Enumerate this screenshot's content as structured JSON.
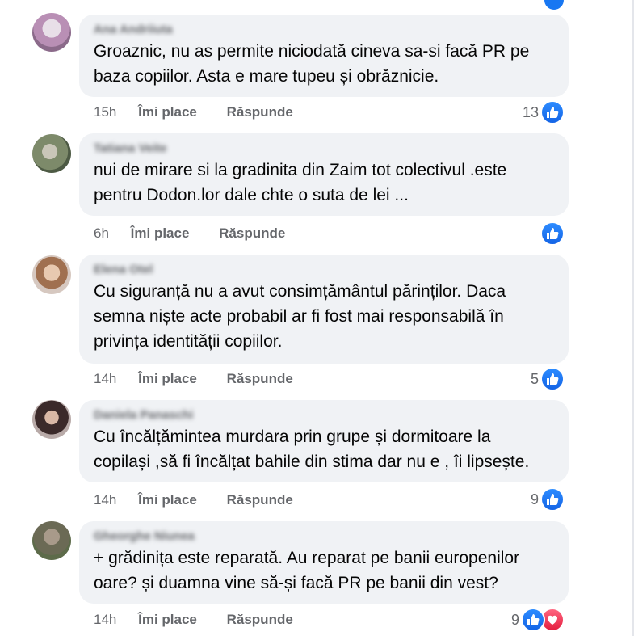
{
  "actions": {
    "like_label": "Îmi place",
    "reply_label": "Răspunde"
  },
  "colors": {
    "like_blue": "#1877f2",
    "love_red": "#f33e58",
    "bubble_bg": "#f0f2f5",
    "meta_gray": "#65676b"
  },
  "icons": {
    "like": "thumbs-up-icon",
    "love": "heart-icon"
  },
  "comments": [
    {
      "author": "Ana Andriiuta",
      "text": "Groaznic, nu as permite niciodată cineva sa-si facă PR pe\nbaza copiilor. Asta e mare tupeu și obrăznicie.",
      "time": "15h",
      "reaction_count": "13",
      "reactions": [
        "like"
      ]
    },
    {
      "author": "Tatiana Veite",
      "text": "nui de mirare si la gradinita din Zaim tot colectivul .este\npentru Dodon.lor dale chte o suta de lei ...",
      "time": "6h",
      "reaction_count": "",
      "reactions": [
        "like"
      ]
    },
    {
      "author": "Elena Otel",
      "text": "Cu siguranță nu a avut consimțământul părinților. Daca\nsemna niște acte probabil ar fi fost mai responsabilă în\nprivința identității copiilor.",
      "time": "14h",
      "reaction_count": "5",
      "reactions": [
        "like"
      ]
    },
    {
      "author": "Daniela Panaschi",
      "text": "Cu încălțămintea murdara prin grupe și dormitoare la\ncopilași ,să fi încălțat bahile din stima dar nu e , îi lipsește.",
      "time": "14h",
      "reaction_count": "9",
      "reactions": [
        "like"
      ]
    },
    {
      "author": "Gheorghe Niunea",
      "text": "+ grădinița este reparată. Au reparat pe banii europenilor\noare? și duamna vine să-și facă PR pe banii din vest?",
      "time": "14h",
      "reaction_count": "9",
      "reactions": [
        "like",
        "love"
      ]
    }
  ]
}
